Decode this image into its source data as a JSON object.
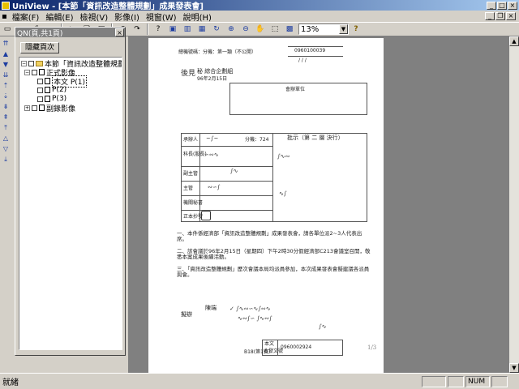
{
  "window": {
    "title": "UniView - [本節「資訊改造整體規劃」成果發表會]"
  },
  "menu": [
    "檔案(F)",
    "編輯(E)",
    "檢視(V)",
    "影像(I)",
    "視窗(W)",
    "說明(H)"
  ],
  "toolbar": {
    "zoom_value": "13%"
  },
  "panel": {
    "title": "QN(頁,共1頁)",
    "hide_button": "隱藏頁次",
    "tree": [
      {
        "label": "本節「資訊改造整體規劃」成果",
        "level": 0
      },
      {
        "label": "正式影像",
        "level": 1
      },
      {
        "label": "本文 P(1)",
        "level": 2,
        "selected": true
      },
      {
        "label": "P(2)",
        "level": 2
      },
      {
        "label": "P(3)",
        "level": 2
      },
      {
        "label": "副錄影像",
        "level": 1
      }
    ]
  },
  "document": {
    "header_left": "總機號碼：分機：第一類（不公開）",
    "header_doc_no": "0960100039",
    "header_date": "/ / /",
    "dept": "秘 綜合企劃組",
    "date_line": "96年2月15日",
    "handwritten_name": "後見",
    "box_label": "會辦單位",
    "approval_title": "批示（第 二 層 決行）",
    "row_labels": [
      "承辦人",
      "科長(股長)",
      "副主管",
      "主管",
      "機關秘書",
      "正本抄發"
    ],
    "ext": "分機：724",
    "items": [
      "一、本件係經濟部「資訊改造整體規劃」成果發表會，請各單位派2~3人代表出席。",
      "二、該會議於96年2月15日（星期四）下午2時30分假經濟部C213會議室召開，敬悉本案成果後續活動。",
      "三、「資訊改造整體規劃」歷次會議本局均派員參加，本次成果發表會擬建議各派員與會。"
    ],
    "footer_sign": "陳端",
    "footer_label": "擬辦",
    "footer_box_labels": [
      "本文",
      "收發文號"
    ],
    "footer_doc_no": "0960002924",
    "footer_left": "B18(第1頁)",
    "page_number": "1/3"
  },
  "status": {
    "text": "就緒",
    "mode": "NUM"
  }
}
